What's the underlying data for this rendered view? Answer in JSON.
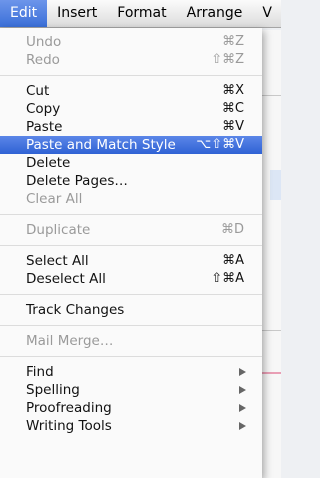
{
  "menubar": {
    "items": [
      "Edit",
      "Insert",
      "Format",
      "Arrange",
      "V"
    ]
  },
  "edit_menu": {
    "undo": {
      "label": "Undo",
      "shortcut": "⌘Z"
    },
    "redo": {
      "label": "Redo",
      "shortcut": "⇧⌘Z"
    },
    "cut": {
      "label": "Cut",
      "shortcut": "⌘X"
    },
    "copy": {
      "label": "Copy",
      "shortcut": "⌘C"
    },
    "paste": {
      "label": "Paste",
      "shortcut": "⌘V"
    },
    "paste_match": {
      "label": "Paste and Match Style",
      "shortcut": "⌥⇧⌘V"
    },
    "delete": {
      "label": "Delete"
    },
    "delete_pages": {
      "label": "Delete Pages…"
    },
    "clear_all": {
      "label": "Clear All"
    },
    "duplicate": {
      "label": "Duplicate",
      "shortcut": "⌘D"
    },
    "select_all": {
      "label": "Select All",
      "shortcut": "⌘A"
    },
    "deselect_all": {
      "label": "Deselect All",
      "shortcut": "⇧⌘A"
    },
    "track_changes": {
      "label": "Track Changes"
    },
    "mail_merge": {
      "label": "Mail Merge…"
    },
    "find": {
      "label": "Find"
    },
    "spelling": {
      "label": "Spelling"
    },
    "proofreading": {
      "label": "Proofreading"
    },
    "writing_tools": {
      "label": "Writing Tools"
    }
  },
  "colors": {
    "highlight": "#2f62d4",
    "disabled_text": "#9a9a9a"
  }
}
